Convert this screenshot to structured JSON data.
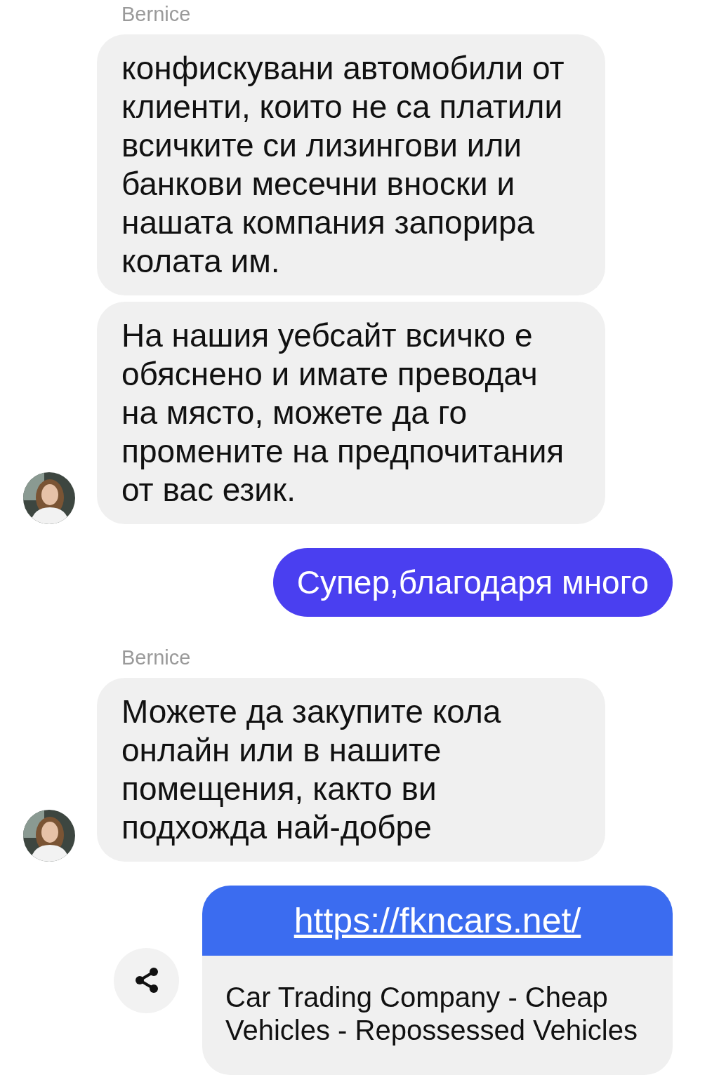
{
  "messages": [
    {
      "kind": "sender",
      "text": "Bernice"
    },
    {
      "kind": "incoming",
      "text": "конфискувани автомобили от клиенти, които не са платили всичките си лизингови или банкови месечни вноски и нашата компания запорира колата им.",
      "avatar": false
    },
    {
      "kind": "incoming",
      "text": "На нашия уебсайт всичко е обяснено и имате преводач на място, можете да го промените на предпочитания от вас език.",
      "avatar": true
    },
    {
      "kind": "outgoing",
      "text": "Супер,благодаря много"
    },
    {
      "kind": "sender",
      "text": "Bernice"
    },
    {
      "kind": "incoming",
      "text": "Можете да закупите кола онлайн или в нашите помещения, както ви подхожда най-добре",
      "avatar": true
    },
    {
      "kind": "link",
      "url": "https://fkncars.net/",
      "title": "Car Trading Company - Cheap Vehicles - Repossessed Vehicles"
    }
  ]
}
